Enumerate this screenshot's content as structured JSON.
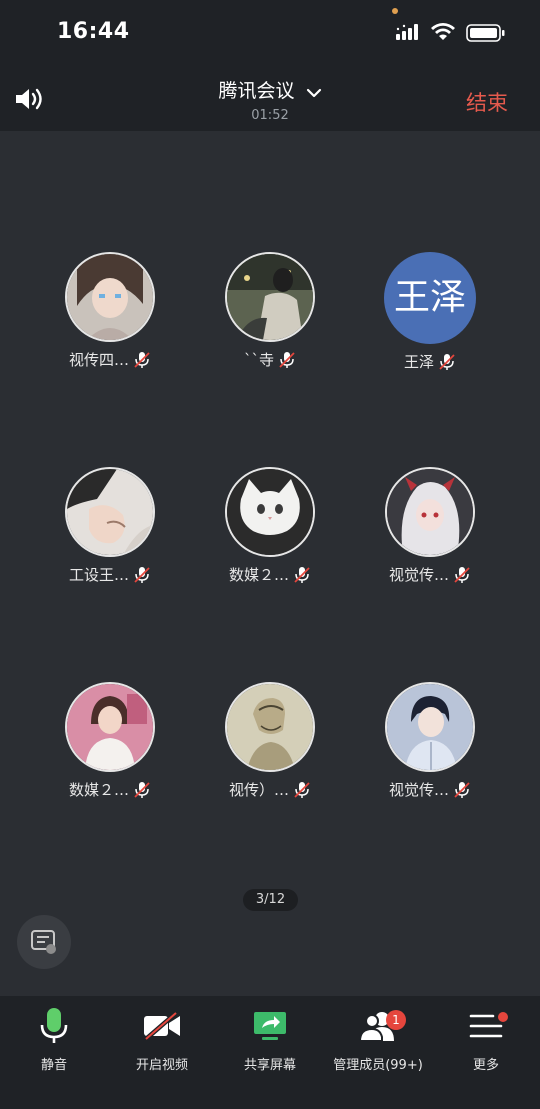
{
  "status_bar": {
    "time": "16:44"
  },
  "header": {
    "title": "腾讯会议",
    "duration": "01:52",
    "end_label": "结束"
  },
  "participants": [
    {
      "name": "视传四…",
      "mic": "muted"
    },
    {
      "name": "``寺",
      "mic": "muted"
    },
    {
      "name": "王泽",
      "avatar_text": "王泽",
      "mic": "muted"
    },
    {
      "name": "工设王…",
      "mic": "muted"
    },
    {
      "name": "数媒２…",
      "mic": "muted"
    },
    {
      "name": "视觉传…",
      "mic": "muted"
    },
    {
      "name": "数媒２…",
      "mic": "muted"
    },
    {
      "name": "视传）…",
      "mic": "muted"
    },
    {
      "name": "视觉传…",
      "mic": "muted"
    }
  ],
  "pagination": {
    "label": "3/12"
  },
  "toolbar": {
    "mute_label": "静音",
    "video_label": "开启视频",
    "share_label": "共享屏幕",
    "members_label": "管理成员(99+)",
    "members_badge": "1",
    "more_label": "更多"
  },
  "colors": {
    "end_red": "#e55a4d",
    "mic_green": "#5fce6a",
    "share_green": "#3dbb6a",
    "badge_red": "#e5463d",
    "avatar_blue": "#4a6fb5"
  }
}
